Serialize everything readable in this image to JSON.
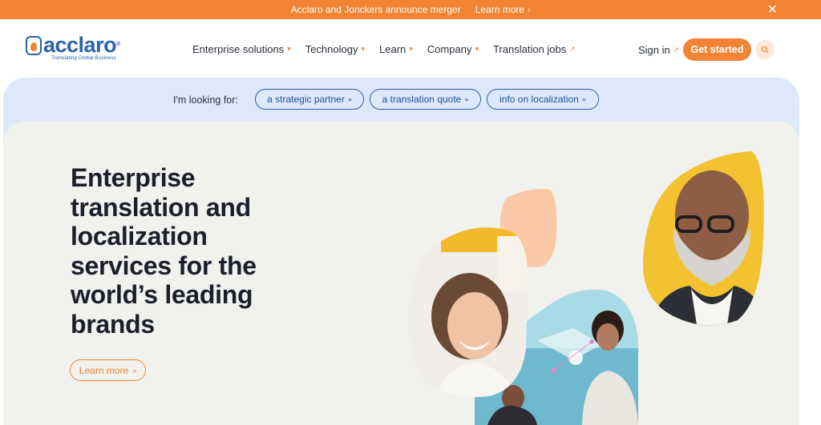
{
  "announcement": {
    "message": "Acclaro and Jonckers announce merger",
    "link_label": "Learn more"
  },
  "logo": {
    "wordmark": "acclaro",
    "trademark": "®",
    "tagline": "Translating Global Business"
  },
  "nav": {
    "items": [
      {
        "label": "Enterprise solutions"
      },
      {
        "label": "Technology"
      },
      {
        "label": "Learn"
      },
      {
        "label": "Company"
      },
      {
        "label": "Translation jobs"
      }
    ],
    "sign_in": "Sign in",
    "cta": "Get started"
  },
  "looking_for": {
    "label": "I'm looking for:",
    "options": [
      {
        "label": "a strategic partner"
      },
      {
        "label": "a translation quote"
      },
      {
        "label": "info on localization"
      }
    ]
  },
  "hero": {
    "headline": "Enterprise translation and localization services for the world’s leading brands",
    "button": "Learn more"
  },
  "colors": {
    "accent": "#f08434",
    "brand_blue": "#2b63b0",
    "panel_blue": "#dde9fb",
    "hero_bg": "#f1f1ee"
  }
}
